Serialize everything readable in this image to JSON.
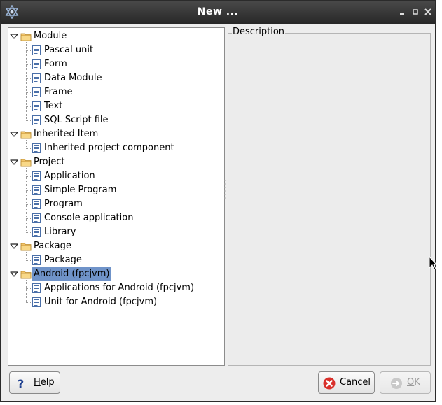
{
  "window": {
    "title": "New ..."
  },
  "tree": {
    "items": [
      {
        "label": "Module",
        "kind": "folder",
        "level": 0,
        "expanded": true
      },
      {
        "label": "Pascal unit",
        "kind": "file",
        "level": 1
      },
      {
        "label": "Form",
        "kind": "file",
        "level": 1
      },
      {
        "label": "Data Module",
        "kind": "file",
        "level": 1
      },
      {
        "label": "Frame",
        "kind": "file",
        "level": 1
      },
      {
        "label": "Text",
        "kind": "file",
        "level": 1
      },
      {
        "label": "SQL Script file",
        "kind": "file",
        "level": 1
      },
      {
        "label": "Inherited Item",
        "kind": "folder",
        "level": 0,
        "expanded": true
      },
      {
        "label": "Inherited project component",
        "kind": "file",
        "level": 1
      },
      {
        "label": "Project",
        "kind": "folder",
        "level": 0,
        "expanded": true
      },
      {
        "label": "Application",
        "kind": "file",
        "level": 1
      },
      {
        "label": "Simple Program",
        "kind": "file",
        "level": 1
      },
      {
        "label": "Program",
        "kind": "file",
        "level": 1
      },
      {
        "label": "Console application",
        "kind": "file",
        "level": 1
      },
      {
        "label": "Library",
        "kind": "file",
        "level": 1
      },
      {
        "label": "Package",
        "kind": "folder",
        "level": 0,
        "expanded": true
      },
      {
        "label": "Package",
        "kind": "file",
        "level": 1
      },
      {
        "label": "Android (fpcjvm)",
        "kind": "folder",
        "level": 0,
        "expanded": true,
        "selected": true
      },
      {
        "label": "Applications for Android (fpcjvm)",
        "kind": "file",
        "level": 1
      },
      {
        "label": "Unit for Android (fpcjvm)",
        "kind": "file",
        "level": 1
      }
    ]
  },
  "description": {
    "label": "Description"
  },
  "buttons": {
    "help": "Help",
    "help_mnemonic": "H",
    "cancel": "Cancel",
    "ok": "OK",
    "ok_mnemonic": "O"
  },
  "colors": {
    "selection": "#6f93c9",
    "titlebar": "#333333",
    "cancel_icon": "#d9302b"
  },
  "icons": {
    "folder": "folder-icon",
    "file": "document-icon",
    "help": "question-icon",
    "cancel": "cancel-icon",
    "ok": "ok-icon"
  }
}
